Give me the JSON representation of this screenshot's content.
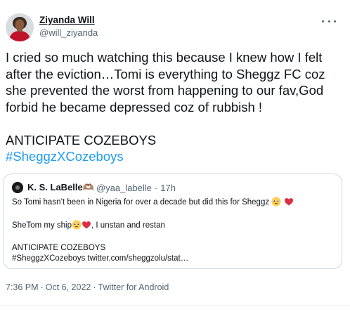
{
  "author": {
    "display_name": "Ziyanda Will",
    "handle": "@will_ziyanda",
    "avatar_icon": "profile-photo"
  },
  "tweet": {
    "text": "I cried so much watching this because I knew how I felt after the eviction…Tomi is everything to Sheggz FC coz she prevented the worst from happening to our fav,God forbid he became depressed coz of rubbish !",
    "line2": "ANTICIPATE COZEBOYS",
    "hashtag": "#SheggzXCozeboys"
  },
  "quoted": {
    "display_name": "K. S. LaBelle",
    "name_emoji": "🫶🏽",
    "handle": "@yaa_labelle",
    "separator": "·",
    "age": "17h",
    "line1": "So Tomi hasn’t been in Nigeria for over a decade but did this for Sheggz",
    "line2_a": "SheTom my ship",
    "line2_b": ", I unstan and restan",
    "line3": "ANTICIPATE COZEBOYS",
    "line4": "#SheggzXCozeboys twitter.com/sheggzolu/stat…"
  },
  "footer": {
    "time": "7:36 PM",
    "separator": "·",
    "date": "Oct 6, 2022",
    "separator2": "·",
    "client": "Twitter for Android"
  },
  "colors": {
    "link": "#1d9bf0",
    "secondary_text": "#536471",
    "border": "#cfd9de",
    "heart": "#e0245e"
  },
  "icons": {
    "more": "more-options-icon",
    "heart": "red-heart-emoji",
    "pleading": "pleading-face-emoji"
  }
}
